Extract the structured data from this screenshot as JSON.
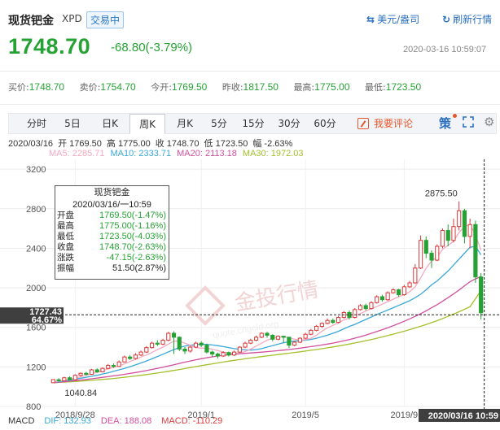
{
  "header": {
    "title": "现货钯金",
    "symbol": "XPD",
    "status": "交易中",
    "fx_link": "美元/盎司",
    "refresh": "刷新行情",
    "price": "1748.70",
    "change": "-68.80(-3.79%)",
    "timestamp": "2020-03-16 10:59:07"
  },
  "stats": [
    {
      "label": "买价:",
      "value": "1748.70"
    },
    {
      "label": "卖价:",
      "value": "1754.70"
    },
    {
      "label": "今开:",
      "value": "1769.50"
    },
    {
      "label": "昨收:",
      "value": "1817.50"
    },
    {
      "label": "最高:",
      "value": "1775.00"
    },
    {
      "label": "最低:",
      "value": "1723.50"
    }
  ],
  "tabs": [
    "分时",
    "5日",
    "日K",
    "周K",
    "月K",
    "5分",
    "15分",
    "30分",
    "60分"
  ],
  "active_tab": "周K",
  "comment_button": "我要评论",
  "strategy_icon_text": "策",
  "ohlc_row": {
    "date": "2020/03/16",
    "open": "开 1769.50",
    "high": "高 1775.00",
    "close": "收 1748.70",
    "low": "低 1723.50",
    "amplitude": "幅 -2.63%"
  },
  "ma_row": [
    {
      "label": "MA5: 2285.71",
      "color": "#f4a9c0"
    },
    {
      "label": "MA10: 2333.71",
      "color": "#3aa8d8"
    },
    {
      "label": "MA20: 2113.18",
      "color": "#d24f9e"
    },
    {
      "label": "MA30: 1972.03",
      "color": "#a4c02c"
    }
  ],
  "tooltip": {
    "title": "现货钯金",
    "date": "2020/03/16/一10:59",
    "rows": [
      {
        "label": "开盘",
        "value": "1769.50(-1.47%)",
        "color": "#26a234"
      },
      {
        "label": "最高",
        "value": "1775.00(-1.16%)",
        "color": "#26a234"
      },
      {
        "label": "最低",
        "value": "1723.50(-4.03%)",
        "color": "#26a234"
      },
      {
        "label": "收盘",
        "value": "1748.70(-2.63%)",
        "color": "#26a234"
      },
      {
        "label": "涨跌",
        "value": "-47.15(-2.63%)",
        "color": "#26a234"
      },
      {
        "label": "振幅",
        "value": "51.50(2.87%)",
        "color": "#222222"
      }
    ]
  },
  "watermark": {
    "text": "金投行情",
    "sub": "quote.cngold.org"
  },
  "macd": {
    "label": "MACD",
    "dif": "DIF: 132.93",
    "dea": "DEA: 188.08",
    "macd": "MACD: -110.29"
  },
  "colors": {
    "up": "#d93a3a",
    "down": "#26a234",
    "ma5": "#f4a9c0",
    "ma10": "#3aa8d8",
    "ma20": "#d24f9e",
    "ma30": "#a4c02c",
    "accent": "#2b6fbf"
  },
  "chart_data": {
    "type": "candlestick",
    "y_ticks": [
      800,
      1200,
      1600,
      2000,
      2400,
      2800,
      3200
    ],
    "ylim": [
      800,
      3300
    ],
    "x_ticks": [
      "2018/9/28",
      "2019/1",
      "2019/5",
      "2019/9",
      "2020/03/16 10:59"
    ],
    "crosshair_value": "1727.43",
    "crosshair_percent": "64.67%",
    "max_label": "2875.50",
    "min_label": "1040.84",
    "grid": true,
    "candles": [
      [
        1040,
        1072,
        1038,
        1075
      ],
      [
        1070,
        1060,
        1050,
        1085
      ],
      [
        1060,
        1090,
        1055,
        1100
      ],
      [
        1090,
        1070,
        1065,
        1105
      ],
      [
        1070,
        1115,
        1065,
        1125
      ],
      [
        1115,
        1135,
        1105,
        1145
      ],
      [
        1135,
        1125,
        1115,
        1150
      ],
      [
        1125,
        1170,
        1120,
        1180
      ],
      [
        1170,
        1150,
        1140,
        1185
      ],
      [
        1150,
        1185,
        1145,
        1195
      ],
      [
        1185,
        1215,
        1175,
        1230
      ],
      [
        1215,
        1205,
        1190,
        1235
      ],
      [
        1205,
        1250,
        1200,
        1265
      ],
      [
        1250,
        1300,
        1245,
        1315
      ],
      [
        1300,
        1285,
        1270,
        1320
      ],
      [
        1285,
        1320,
        1275,
        1340
      ],
      [
        1320,
        1350,
        1310,
        1365
      ],
      [
        1350,
        1395,
        1340,
        1410
      ],
      [
        1395,
        1440,
        1385,
        1455
      ],
      [
        1440,
        1430,
        1410,
        1470
      ],
      [
        1430,
        1470,
        1420,
        1485
      ],
      [
        1470,
        1540,
        1460,
        1555
      ],
      [
        1540,
        1500,
        1330,
        1560
      ],
      [
        1500,
        1380,
        1360,
        1510
      ],
      [
        1380,
        1360,
        1330,
        1400
      ],
      [
        1360,
        1400,
        1345,
        1415
      ],
      [
        1400,
        1440,
        1390,
        1455
      ],
      [
        1440,
        1420,
        1400,
        1460
      ],
      [
        1420,
        1350,
        1335,
        1435
      ],
      [
        1350,
        1330,
        1300,
        1365
      ],
      [
        1330,
        1310,
        1285,
        1345
      ],
      [
        1310,
        1345,
        1300,
        1360
      ],
      [
        1345,
        1320,
        1305,
        1355
      ],
      [
        1320,
        1350,
        1310,
        1365
      ],
      [
        1350,
        1400,
        1340,
        1410
      ],
      [
        1400,
        1440,
        1390,
        1455
      ],
      [
        1440,
        1470,
        1430,
        1485
      ],
      [
        1470,
        1500,
        1460,
        1515
      ],
      [
        1500,
        1540,
        1490,
        1550
      ],
      [
        1540,
        1520,
        1495,
        1555
      ],
      [
        1520,
        1480,
        1460,
        1530
      ],
      [
        1480,
        1510,
        1470,
        1520
      ],
      [
        1510,
        1500,
        1440,
        1515
      ],
      [
        1500,
        1420,
        1390,
        1505
      ],
      [
        1420,
        1450,
        1410,
        1465
      ],
      [
        1450,
        1490,
        1440,
        1500
      ],
      [
        1490,
        1530,
        1480,
        1545
      ],
      [
        1530,
        1570,
        1520,
        1585
      ],
      [
        1570,
        1610,
        1560,
        1625
      ],
      [
        1610,
        1640,
        1595,
        1650
      ],
      [
        1640,
        1670,
        1630,
        1690
      ],
      [
        1670,
        1650,
        1635,
        1690
      ],
      [
        1650,
        1700,
        1640,
        1715
      ],
      [
        1700,
        1750,
        1690,
        1765
      ],
      [
        1750,
        1700,
        1680,
        1770
      ],
      [
        1700,
        1780,
        1690,
        1795
      ],
      [
        1780,
        1820,
        1770,
        1835
      ],
      [
        1820,
        1790,
        1770,
        1840
      ],
      [
        1790,
        1850,
        1780,
        1865
      ],
      [
        1850,
        1910,
        1840,
        1925
      ],
      [
        1910,
        1880,
        1860,
        1930
      ],
      [
        1880,
        1950,
        1870,
        1965
      ],
      [
        1950,
        1980,
        1940,
        1995
      ],
      [
        1980,
        1930,
        1910,
        1990
      ],
      [
        1930,
        2010,
        1920,
        2030
      ],
      [
        2010,
        2050,
        2000,
        2070
      ],
      [
        2050,
        2200,
        2040,
        2240
      ],
      [
        2200,
        2480,
        2190,
        2530
      ],
      [
        2480,
        2350,
        2300,
        2520
      ],
      [
        2350,
        2280,
        2200,
        2380
      ],
      [
        2280,
        2420,
        2270,
        2440
      ],
      [
        2420,
        2580,
        2400,
        2600
      ],
      [
        2580,
        2480,
        2420,
        2640
      ],
      [
        2480,
        2620,
        2460,
        2700
      ],
      [
        2620,
        2780,
        2580,
        2875
      ],
      [
        2780,
        2520,
        2450,
        2800
      ],
      [
        2520,
        2640,
        2400,
        2700
      ],
      [
        2640,
        2110,
        2050,
        2680
      ],
      [
        2110,
        1748,
        1680,
        2150
      ]
    ],
    "ma5": [
      1045,
      1055,
      1065,
      1075,
      1085,
      1100,
      1115,
      1130,
      1145,
      1160,
      1180,
      1195,
      1210,
      1230,
      1255,
      1275,
      1300,
      1320,
      1345,
      1375,
      1400,
      1430,
      1460,
      1460,
      1440,
      1420,
      1395,
      1390,
      1390,
      1380,
      1365,
      1350,
      1340,
      1335,
      1340,
      1355,
      1380,
      1410,
      1440,
      1470,
      1490,
      1500,
      1505,
      1495,
      1480,
      1470,
      1475,
      1490,
      1520,
      1560,
      1595,
      1620,
      1645,
      1675,
      1695,
      1715,
      1740,
      1765,
      1790,
      1810,
      1835,
      1860,
      1885,
      1910,
      1930,
      1960,
      2010,
      2100,
      2200,
      2270,
      2310,
      2390,
      2430,
      2470,
      2560,
      2620,
      2640,
      2540,
      2380
    ],
    "ma10": [
      1045,
      1050,
      1058,
      1066,
      1075,
      1085,
      1095,
      1105,
      1115,
      1128,
      1140,
      1155,
      1170,
      1185,
      1202,
      1220,
      1240,
      1260,
      1282,
      1305,
      1328,
      1352,
      1375,
      1395,
      1410,
      1420,
      1425,
      1430,
      1428,
      1422,
      1415,
      1405,
      1395,
      1385,
      1378,
      1372,
      1370,
      1375,
      1385,
      1400,
      1415,
      1430,
      1445,
      1455,
      1460,
      1465,
      1470,
      1478,
      1490,
      1505,
      1520,
      1540,
      1560,
      1585,
      1610,
      1630,
      1655,
      1680,
      1705,
      1730,
      1752,
      1775,
      1798,
      1822,
      1845,
      1870,
      1900,
      1935,
      1980,
      2030,
      2070,
      2120,
      2170,
      2230,
      2290,
      2350,
      2410,
      2420,
      2334
    ],
    "ma20": [
      1040,
      1045,
      1050,
      1055,
      1061,
      1067,
      1073,
      1080,
      1087,
      1094,
      1101,
      1109,
      1117,
      1125,
      1134,
      1143,
      1153,
      1163,
      1174,
      1185,
      1197,
      1209,
      1222,
      1235,
      1248,
      1260,
      1272,
      1283,
      1293,
      1302,
      1310,
      1317,
      1323,
      1328,
      1333,
      1337,
      1341,
      1345,
      1349,
      1354,
      1359,
      1364,
      1370,
      1376,
      1383,
      1390,
      1397,
      1405,
      1413,
      1422,
      1431,
      1441,
      1452,
      1464,
      1477,
      1491,
      1506,
      1522,
      1539,
      1557,
      1576,
      1596,
      1617,
      1639,
      1662,
      1686,
      1711,
      1738,
      1767,
      1798,
      1830,
      1864,
      1900,
      1938,
      1978,
      2020,
      2062,
      2090,
      2113
    ],
    "ma30": [
      1040,
      1043,
      1046,
      1049,
      1052,
      1056,
      1060,
      1064,
      1068,
      1073,
      1078,
      1083,
      1089,
      1095,
      1101,
      1108,
      1115,
      1122,
      1130,
      1138,
      1146,
      1155,
      1164,
      1173,
      1183,
      1193,
      1203,
      1213,
      1222,
      1231,
      1240,
      1249,
      1258,
      1266,
      1274,
      1282,
      1290,
      1297,
      1304,
      1311,
      1318,
      1325,
      1332,
      1339,
      1346,
      1353,
      1360,
      1368,
      1376,
      1384,
      1393,
      1402,
      1411,
      1421,
      1431,
      1442,
      1453,
      1465,
      1477,
      1490,
      1503,
      1517,
      1531,
      1546,
      1561,
      1577,
      1594,
      1611,
      1629,
      1648,
      1668,
      1689,
      1711,
      1734,
      1758,
      1783,
      1809,
      1890,
      1972
    ]
  }
}
